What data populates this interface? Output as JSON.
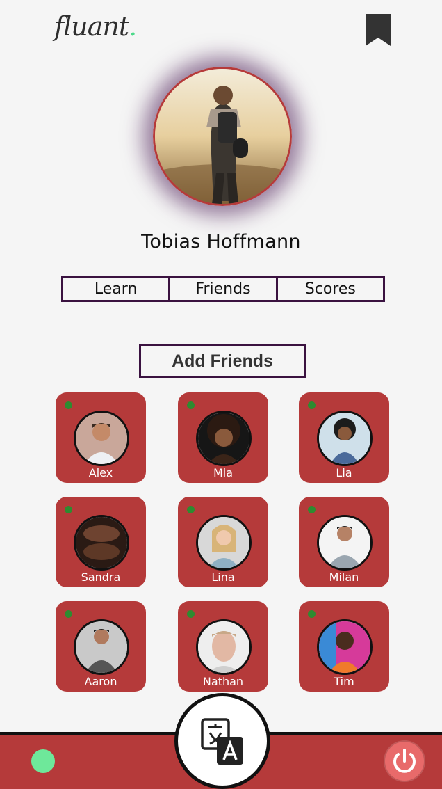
{
  "app": {
    "logo_text": "fluant",
    "logo_dot": "."
  },
  "profile": {
    "name": "Tobias Hoffmann"
  },
  "tabs": [
    {
      "label": "Learn"
    },
    {
      "label": "Friends"
    },
    {
      "label": "Scores"
    }
  ],
  "add_friends": {
    "label": "Add Friends"
  },
  "friends": [
    {
      "name": "Alex",
      "online": true
    },
    {
      "name": "Mia",
      "online": true
    },
    {
      "name": "Lia",
      "online": true
    },
    {
      "name": "Sandra",
      "online": true
    },
    {
      "name": "Lina",
      "online": true
    },
    {
      "name": "Milan",
      "online": true
    },
    {
      "name": "Aaron",
      "online": true
    },
    {
      "name": "Nathan",
      "online": true
    },
    {
      "name": "Tim",
      "online": true
    }
  ],
  "colors": {
    "brand_red": "#b53a3a",
    "accent_purple": "#3a1240",
    "online_green": "#2e8b30",
    "status_green": "#6ee89a",
    "power_pink": "#e86a6a"
  },
  "icons": {
    "bookmark": "bookmark-icon",
    "translate": "translate-icon",
    "power": "power-icon"
  }
}
